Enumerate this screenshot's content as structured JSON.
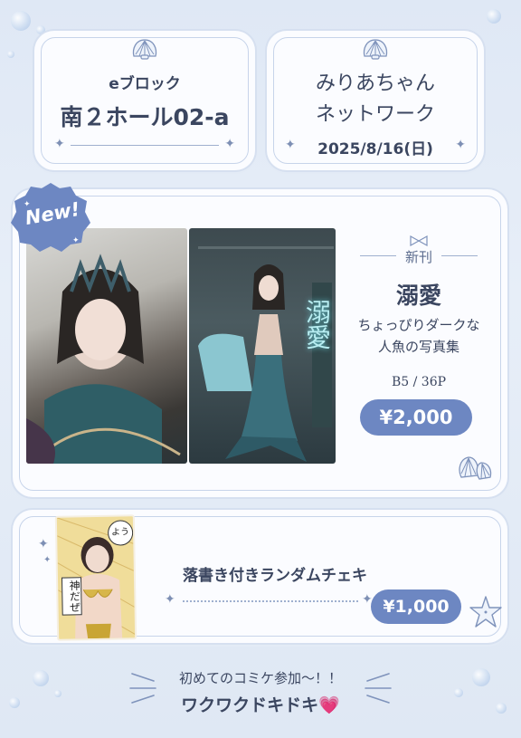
{
  "header_left": {
    "block": "eブロック",
    "hall": "南２ホール02-a"
  },
  "header_right": {
    "line1": "みりあちゃん",
    "line2": "ネットワーク",
    "date": "2025/8/16(日)"
  },
  "new_item": {
    "badge": "New!",
    "tag": "新刊",
    "title": "溺愛",
    "desc_line1": "ちょっぴりダークな",
    "desc_line2": "人魚の写真集",
    "spec": "B5 / 36P",
    "price": "¥2,000",
    "cover_text": "溺愛"
  },
  "cheki": {
    "title": "落書き付きランダムチェキ",
    "price": "¥1,000",
    "doodle_top": "よう",
    "doodle_bottom": "神だぜ"
  },
  "footer": {
    "line1": "初めてのコミケ参加〜！！",
    "line2": "ワクワクドキドキ💗"
  },
  "colors": {
    "accent": "#6d87c2",
    "text": "#3b4660",
    "background": "#e3ebf6"
  }
}
